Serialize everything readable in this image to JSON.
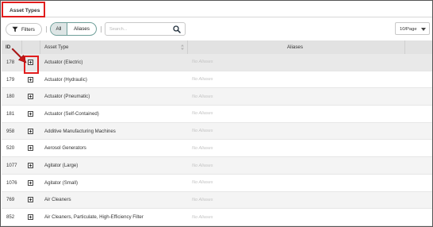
{
  "tab": {
    "label": "Asset Types"
  },
  "toolbar": {
    "filters_label": "Filters",
    "segment": {
      "all_label": "All",
      "aliases_label": "Aliases",
      "selected": "All"
    },
    "search_placeholder": "Search...",
    "per_page": "10/Page"
  },
  "table": {
    "columns": {
      "id": "ID",
      "asset_type": "Asset Type",
      "aliases": "Aliases"
    },
    "rows": [
      {
        "id": "178",
        "asset_type": "Actuator (Electric)",
        "aliases": "No Aliases"
      },
      {
        "id": "179",
        "asset_type": "Actuator (Hydraulic)",
        "aliases": "No Aliases"
      },
      {
        "id": "180",
        "asset_type": "Actuator (Pneumatic)",
        "aliases": "No Aliases"
      },
      {
        "id": "181",
        "asset_type": "Actuator (Self-Contained)",
        "aliases": "No Aliases"
      },
      {
        "id": "958",
        "asset_type": "Additive Manufacturing Machines",
        "aliases": "No Aliases"
      },
      {
        "id": "520",
        "asset_type": "Aerosol Generators",
        "aliases": "No Aliases"
      },
      {
        "id": "1077",
        "asset_type": "Agitator (Large)",
        "aliases": "No Aliases"
      },
      {
        "id": "1076",
        "asset_type": "Agitator (Small)",
        "aliases": "No Aliases"
      },
      {
        "id": "769",
        "asset_type": "Air Cleaners",
        "aliases": "No Aliases"
      },
      {
        "id": "852",
        "asset_type": "Air Cleaners, Particulate, High-Efficiency Filter",
        "aliases": "No Aliases"
      }
    ]
  },
  "colors": {
    "highlight": "#e11d1d",
    "segment_border": "#6f9f9a",
    "header_bg": "#e2e2e2"
  },
  "icons": {
    "filter": "filter-icon",
    "search": "search-icon",
    "expand": "expand-plus-icon",
    "sort": "sort-icon",
    "pointer": "arrow-annotation-icon"
  }
}
